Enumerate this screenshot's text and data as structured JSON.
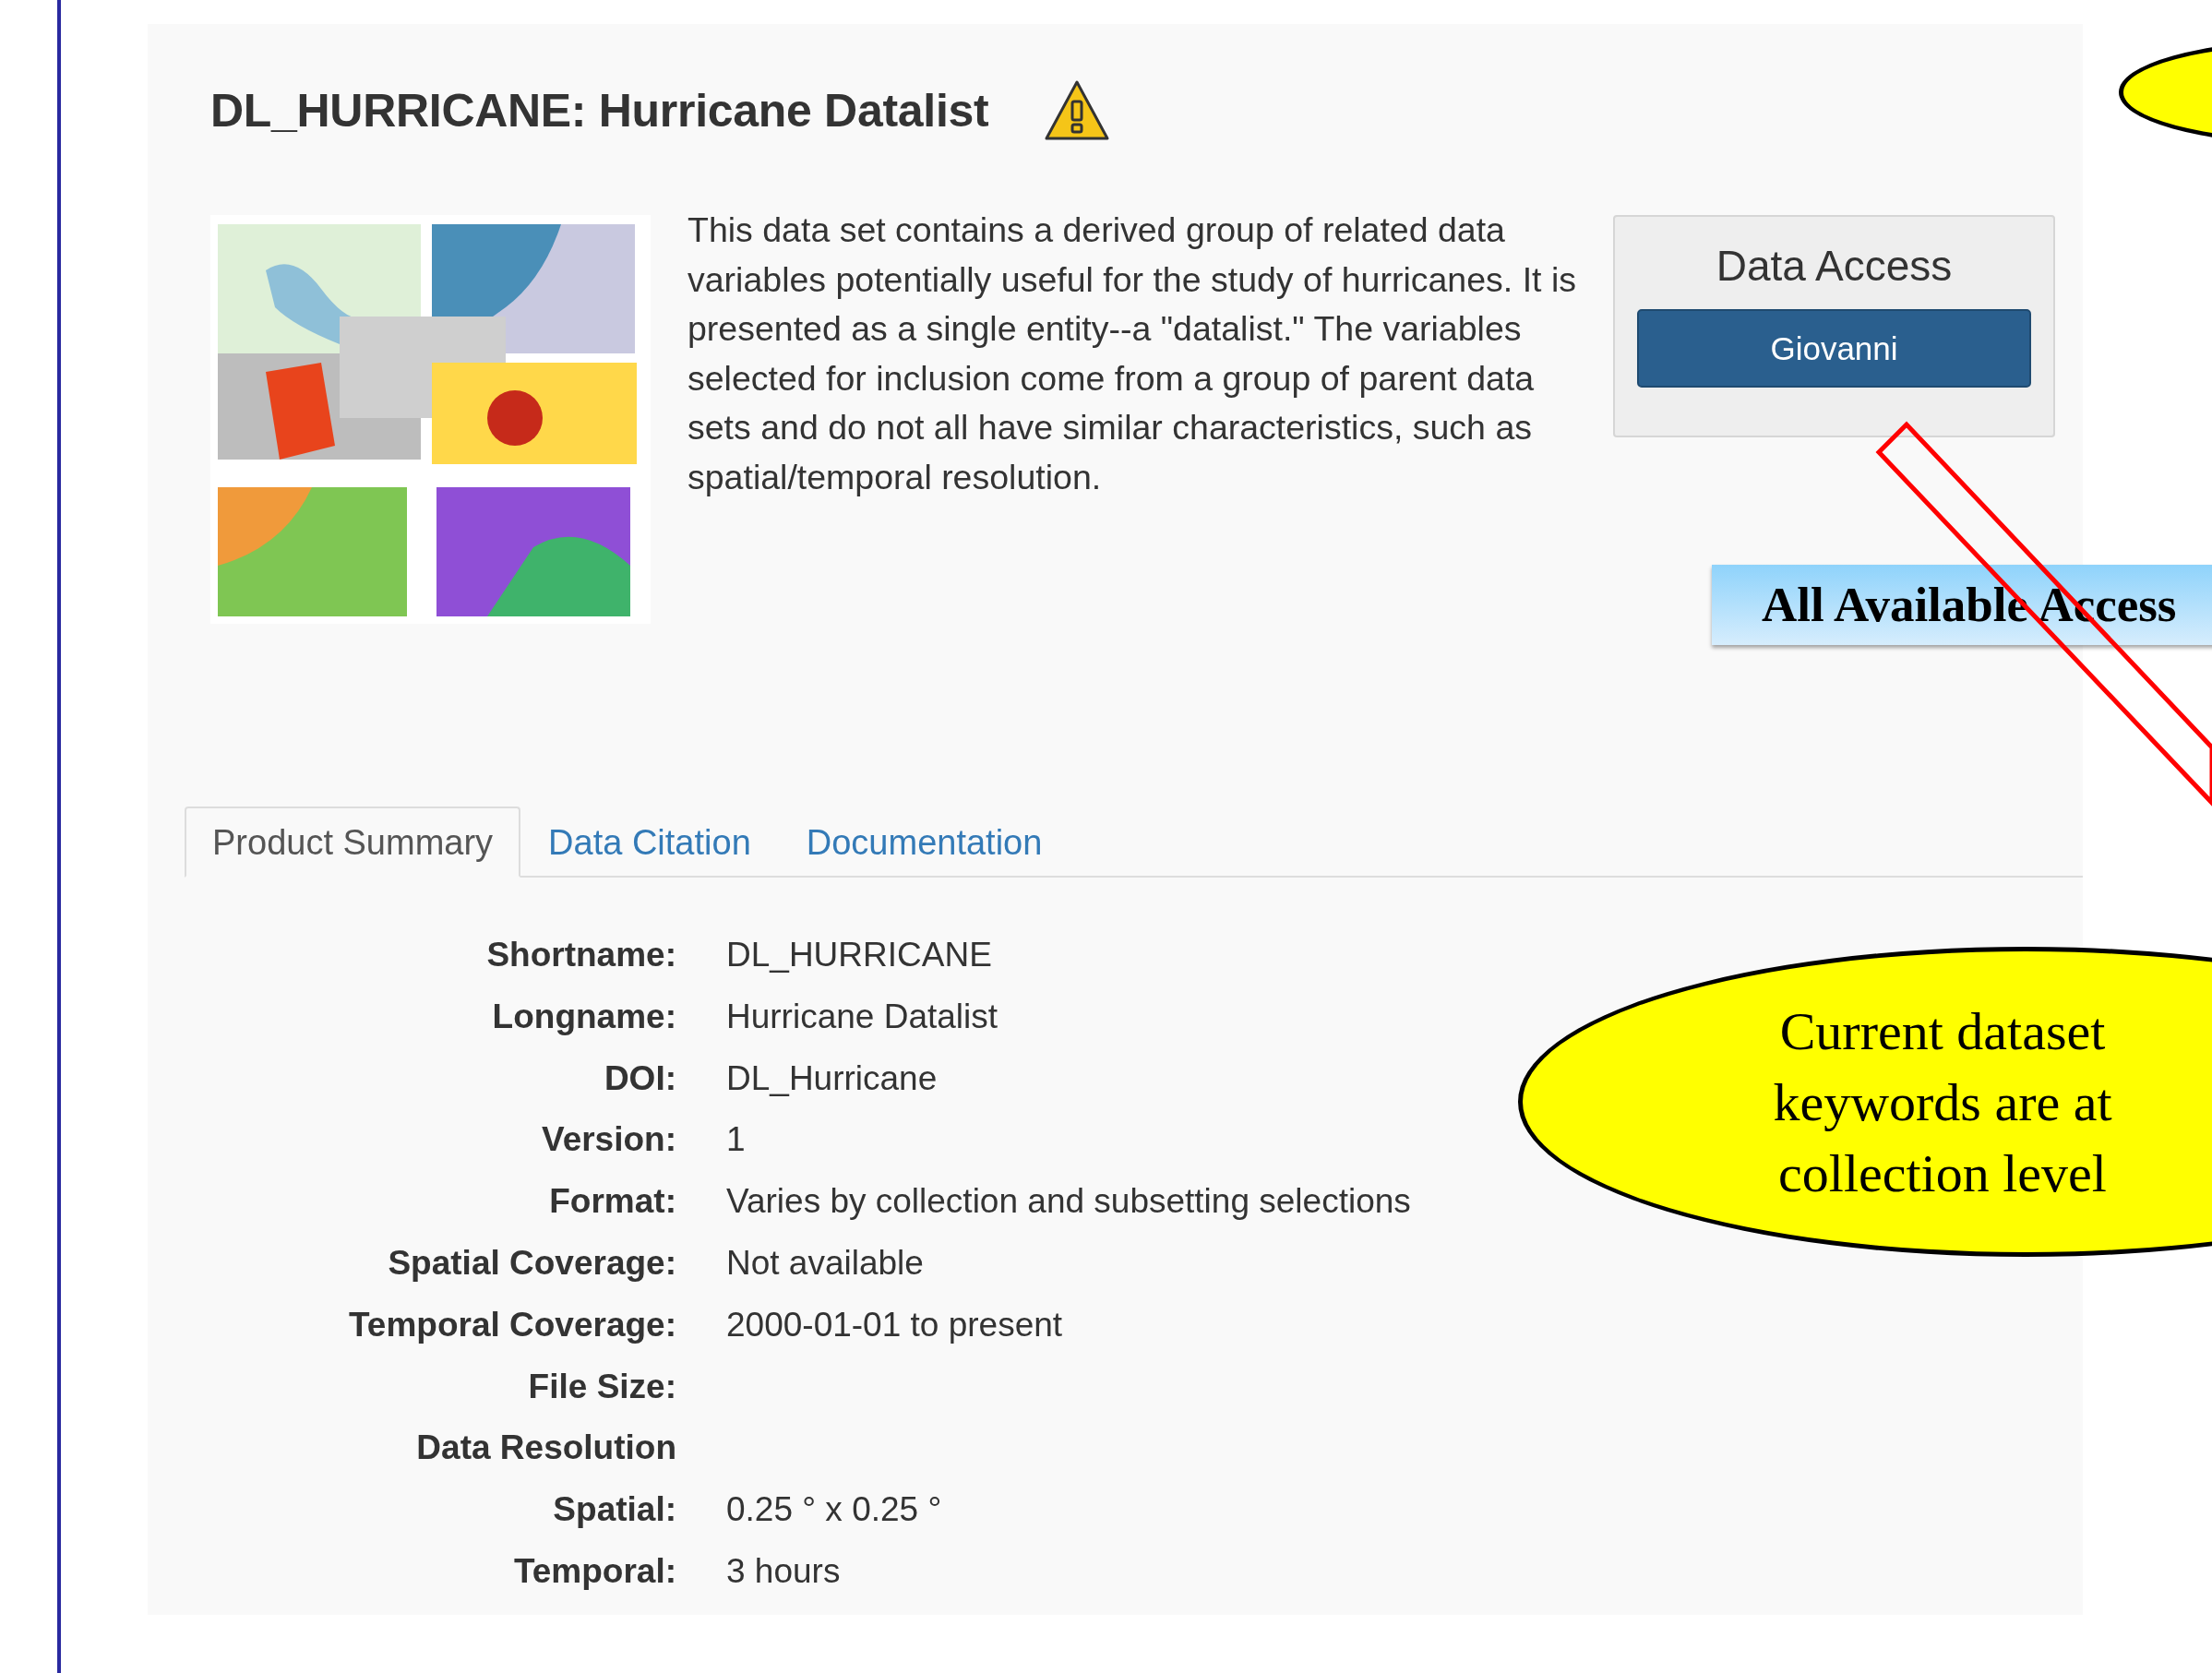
{
  "panel": {
    "title": "DL_HURRICANE: Hurricane Datalist",
    "description": "This data set contains a derived group of related data variables potentially useful for the study of hurricanes. It is presented as a single entity--a \"datalist.\" The variables selected for inclusion come from a group of parent data sets and do not all have similar characteristics, such as spatial/temporal resolution.",
    "data_access": {
      "heading": "Data Access",
      "buttons": [
        "Giovanni"
      ]
    }
  },
  "tabs": [
    {
      "label": "Product Summary",
      "selected": true
    },
    {
      "label": "Data Citation",
      "selected": false
    },
    {
      "label": "Documentation",
      "selected": false
    }
  ],
  "details": [
    {
      "label": "Shortname:",
      "value": "DL_HURRICANE"
    },
    {
      "label": "Longname:",
      "value": "Hurricane Datalist"
    },
    {
      "label": "DOI:",
      "value": "DL_Hurricane"
    },
    {
      "label": "Version:",
      "value": "1"
    },
    {
      "label": "Format:",
      "value": "Varies by collection and subsetting selections"
    },
    {
      "label": "Spatial Coverage:",
      "value": "Not available"
    },
    {
      "label": "Temporal Coverage:",
      "value": "2000-01-01 to present"
    },
    {
      "label": "File Size:"
    },
    {
      "label": "Data Resolution"
    },
    {
      "label": "Spatial:",
      "value": "0.25 ° x 0.25 °"
    },
    {
      "label": "Temporal:",
      "value": "3 hours"
    }
  ],
  "annotations": [
    {
      "kind": "ellipse"
    },
    {
      "kind": "banner",
      "text": "All Available Access"
    },
    {
      "kind": "pointer"
    },
    {
      "kind": "ellipse",
      "text": "Current dataset keywords are at collection level"
    }
  ]
}
